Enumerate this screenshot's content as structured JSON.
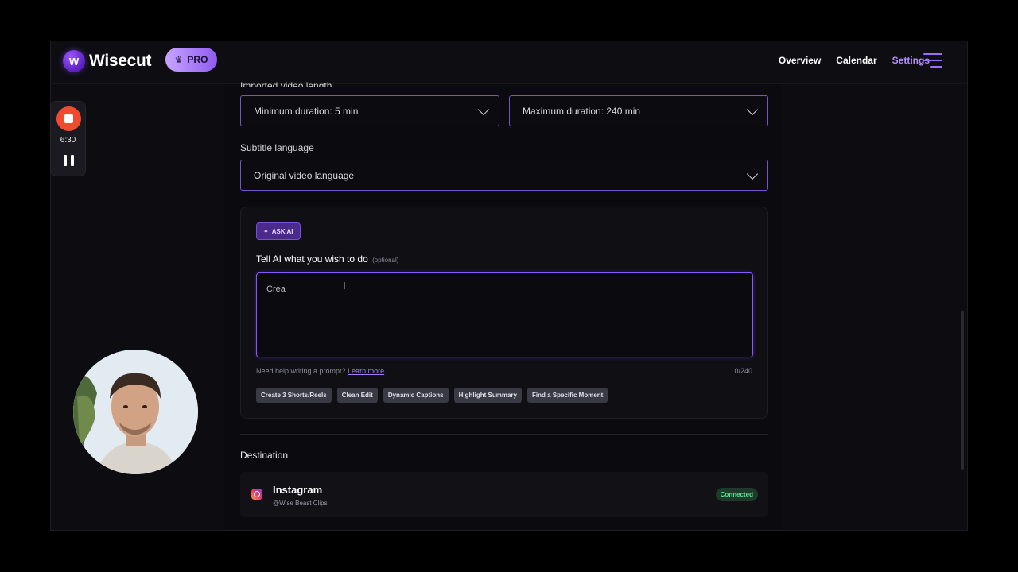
{
  "app": {
    "name": "Wisecut",
    "logo_letter": "W",
    "badge": "PRO"
  },
  "nav": {
    "items": [
      "Overview",
      "Calendar",
      "Settings"
    ],
    "active": "Settings"
  },
  "settings": {
    "video_length_label": "Imported video length",
    "min_duration": "Minimum duration: 5 min",
    "max_duration": "Maximum duration: 240 min",
    "subtitle_label": "Subtitle language",
    "subtitle_value": "Original video language"
  },
  "ai": {
    "badge": "ASK AI",
    "title": "Tell AI what you wish to do",
    "optional": "(optional)",
    "prompt_value": "Crea",
    "help_text": "Need help writing a prompt?",
    "help_link": "Learn more",
    "counter": "0/240",
    "chips": [
      "Create 3 Shorts/Reels",
      "Clean Edit",
      "Dynamic Captions",
      "Highlight Summary",
      "Find a Specific Moment"
    ]
  },
  "destination": {
    "label": "Destination",
    "platform": "Instagram",
    "handle": "@Wise Beast Clips",
    "status": "Connected"
  },
  "recorder": {
    "time": "6:30"
  },
  "icons": {
    "crown": "crown-icon",
    "menu": "hamburger-menu-icon",
    "chevron": "chevron-down-icon",
    "sparkle": "sparkle-icon",
    "instagram": "instagram-icon",
    "record": "stop-record-icon",
    "pause": "pause-icon"
  },
  "colors": {
    "accent": "#8a56ff",
    "active_nav": "#b48cff",
    "record": "#f04b30",
    "connected": "#5fe08d"
  }
}
